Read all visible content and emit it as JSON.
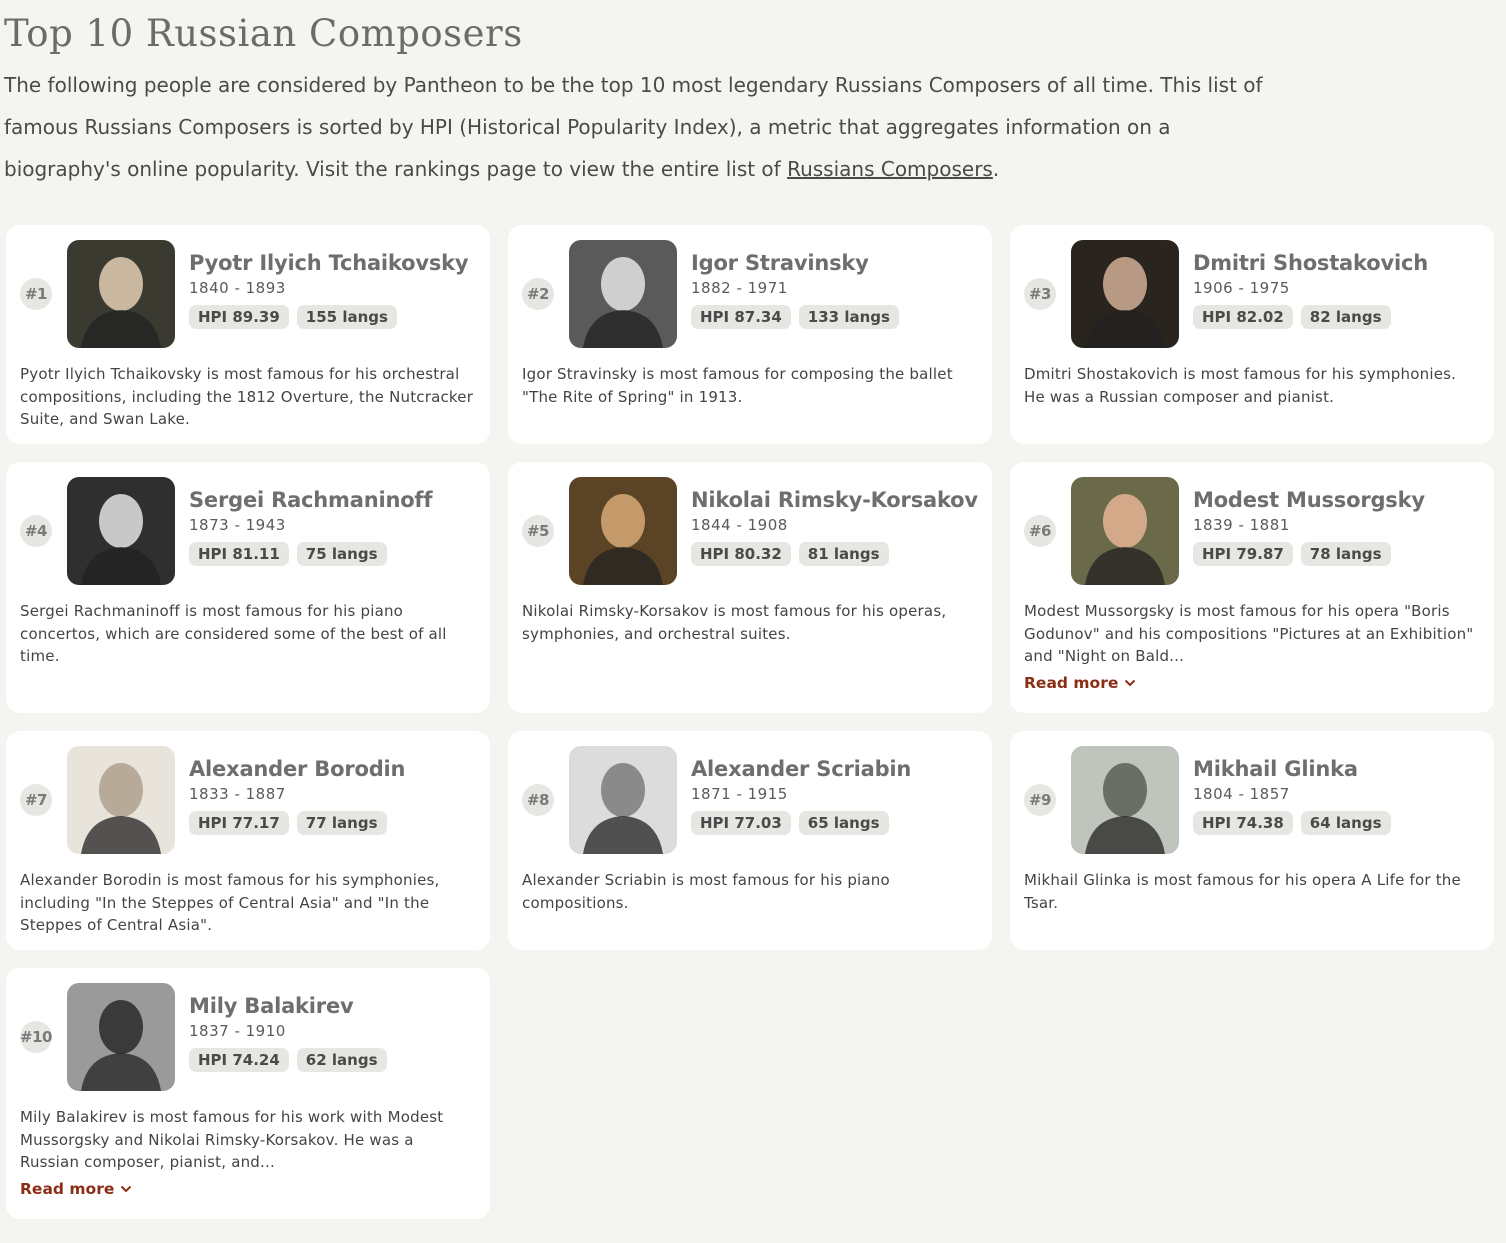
{
  "page": {
    "title": "Top 10 Russian Composers",
    "intro_text": "The following people are considered by Pantheon to be the top 10 most legendary Russians Composers of all time. This list of famous Russians Composers is sorted by HPI (Historical Popularity Index), a metric that aggregates information on a biography's online popularity. Visit the rankings page to view the entire list of ",
    "intro_link": "Russians Composers",
    "intro_end": "."
  },
  "read_more_label": "Read more",
  "people": [
    {
      "rank": "#1",
      "name": "Pyotr Ilyich Tchaikovsky",
      "years": "1840 - 1893",
      "hpi": "HPI 89.39",
      "langs": "155 langs",
      "desc": "Pyotr Ilyich Tchaikovsky is most famous for his orchestral compositions, including the 1812 Overture, the Nutcracker Suite, and Swan Lake.",
      "tone": "#3a3a30",
      "face": "#c9b79f"
    },
    {
      "rank": "#2",
      "name": "Igor Stravinsky",
      "years": "1882 - 1971",
      "hpi": "HPI 87.34",
      "langs": "133 langs",
      "desc": "Igor Stravinsky is most famous for composing the ballet \"The Rite of Spring\" in 1913.",
      "tone": "#5a5a5a",
      "face": "#cfcfcf"
    },
    {
      "rank": "#3",
      "name": "Dmitri Shostakovich",
      "years": "1906 - 1975",
      "hpi": "HPI 82.02",
      "langs": "82 langs",
      "desc": "Dmitri Shostakovich is most famous for his symphonies. He was a Russian composer and pianist.",
      "tone": "#2a241f",
      "face": "#b89a84"
    },
    {
      "rank": "#4",
      "name": "Sergei Rachmaninoff",
      "years": "1873 - 1943",
      "hpi": "HPI 81.11",
      "langs": "75 langs",
      "desc": "Sergei Rachmaninoff is most famous for his piano concertos, which are considered some of the best of all time.",
      "tone": "#2f2f2f",
      "face": "#c8c8c8"
    },
    {
      "rank": "#5",
      "name": "Nikolai Rimsky-Korsakov",
      "years": "1844 - 1908",
      "hpi": "HPI 80.32",
      "langs": "81 langs",
      "desc": "Nikolai Rimsky-Korsakov is most famous for his operas, symphonies, and orchestral suites.",
      "tone": "#5b4426",
      "face": "#c49a6a"
    },
    {
      "rank": "#6",
      "name": "Modest Mussorgsky",
      "years": "1839 - 1881",
      "hpi": "HPI 79.87",
      "langs": "78 langs",
      "desc": "Modest Mussorgsky is most famous for his opera \"Boris Godunov\" and his compositions \"Pictures at an Exhibition\" and \"Night on Bald...",
      "more": true,
      "tone": "#6a6a4a",
      "face": "#d3a98a"
    },
    {
      "rank": "#7",
      "name": "Alexander Borodin",
      "years": "1833 - 1887",
      "hpi": "HPI 77.17",
      "langs": "77 langs",
      "desc": "Alexander Borodin is most famous for his symphonies, including \"In the Steppes of Central Asia\" and \"In the Steppes of Central Asia\".",
      "tone": "#e8e4dc",
      "face": "#b8aa98"
    },
    {
      "rank": "#8",
      "name": "Alexander Scriabin",
      "years": "1871 - 1915",
      "hpi": "HPI 77.03",
      "langs": "65 langs",
      "desc": "Alexander Scriabin is most famous for his piano compositions.",
      "tone": "#dcdcdc",
      "face": "#8a8a8a"
    },
    {
      "rank": "#9",
      "name": "Mikhail Glinka",
      "years": "1804 - 1857",
      "hpi": "HPI 74.38",
      "langs": "64 langs",
      "desc": "Mikhail Glinka is most famous for his opera A Life for the Tsar.",
      "tone": "#bfc4bc",
      "face": "#6a6e66"
    },
    {
      "rank": "#10",
      "name": "Mily Balakirev",
      "years": "1837 - 1910",
      "hpi": "HPI 74.24",
      "langs": "62 langs",
      "desc": "Mily Balakirev is most famous for his work with Modest Mussorgsky and Nikolai Rimsky-Korsakov. He was a Russian composer, pianist, and...",
      "more": true,
      "tone": "#9a9a9a",
      "face": "#3a3a3a"
    }
  ]
}
